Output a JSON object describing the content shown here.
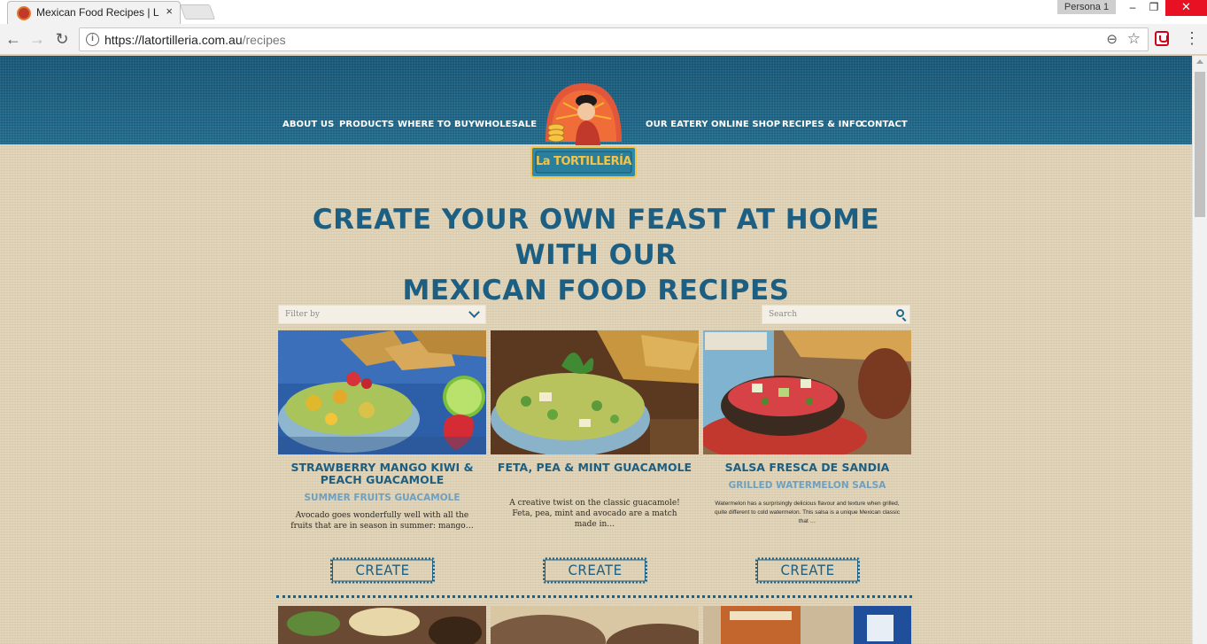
{
  "browser": {
    "tab_title": "Mexican Food Recipes | L",
    "tab_close": "×",
    "persona": "Persona 1",
    "window_min": "–",
    "window_max": "❐",
    "window_close": "✕",
    "url_host": "https://latortilleria.com.au",
    "url_path": "/recipes",
    "back_glyph": "←",
    "forward_glyph": "→",
    "reload_glyph": "↻",
    "star_glyph": "☆",
    "zoom_glyph": "⊖",
    "menu_glyph": "⋮",
    "info_glyph": "i"
  },
  "nav": {
    "left": [
      "ABOUT US",
      "PRODUCTS",
      "WHERE TO BUY",
      "WHOLESALE"
    ],
    "right": [
      "OUR EATERY",
      "ONLINE SHOP",
      "RECIPES & INFO",
      "CONTACT"
    ]
  },
  "logo": {
    "text": "La TORTILLERÍA"
  },
  "hero": {
    "line1": "CREATE YOUR OWN FEAST AT HOME WITH OUR",
    "line2": "MEXICAN FOOD RECIPES"
  },
  "filter": {
    "placeholder": "Filter by"
  },
  "search": {
    "placeholder": "Search"
  },
  "cards": [
    {
      "title": "STRAWBERRY MANGO KIWI & PEACH GUACAMOLE",
      "subtitle": "SUMMER FRUITS GUACAMOLE",
      "description": "Avocado goes wonderfully well with all the fruits that are in season in summer: mango…",
      "button": "CREATE"
    },
    {
      "title": "FETA, PEA & MINT GUACAMOLE",
      "subtitle": "",
      "description": "A creative twist on the classic guacamole! Feta, pea, mint and avocado are a match made in…",
      "button": "CREATE"
    },
    {
      "title": "SALSA FRESCA DE SANDIA",
      "subtitle": "GRILLED WATERMELON SALSA",
      "description": "Watermelon has a surprisingly delicious flavour and texture when grilled, quite different to cold watermelon. This salsa is a unique Mexican classic that …",
      "button": "CREATE"
    }
  ],
  "colors": {
    "header_blue": "#1f6586",
    "title_blue": "#1c5f82",
    "subtitle_blue": "#6fa0bf",
    "burlap": "#dfd2b6"
  }
}
